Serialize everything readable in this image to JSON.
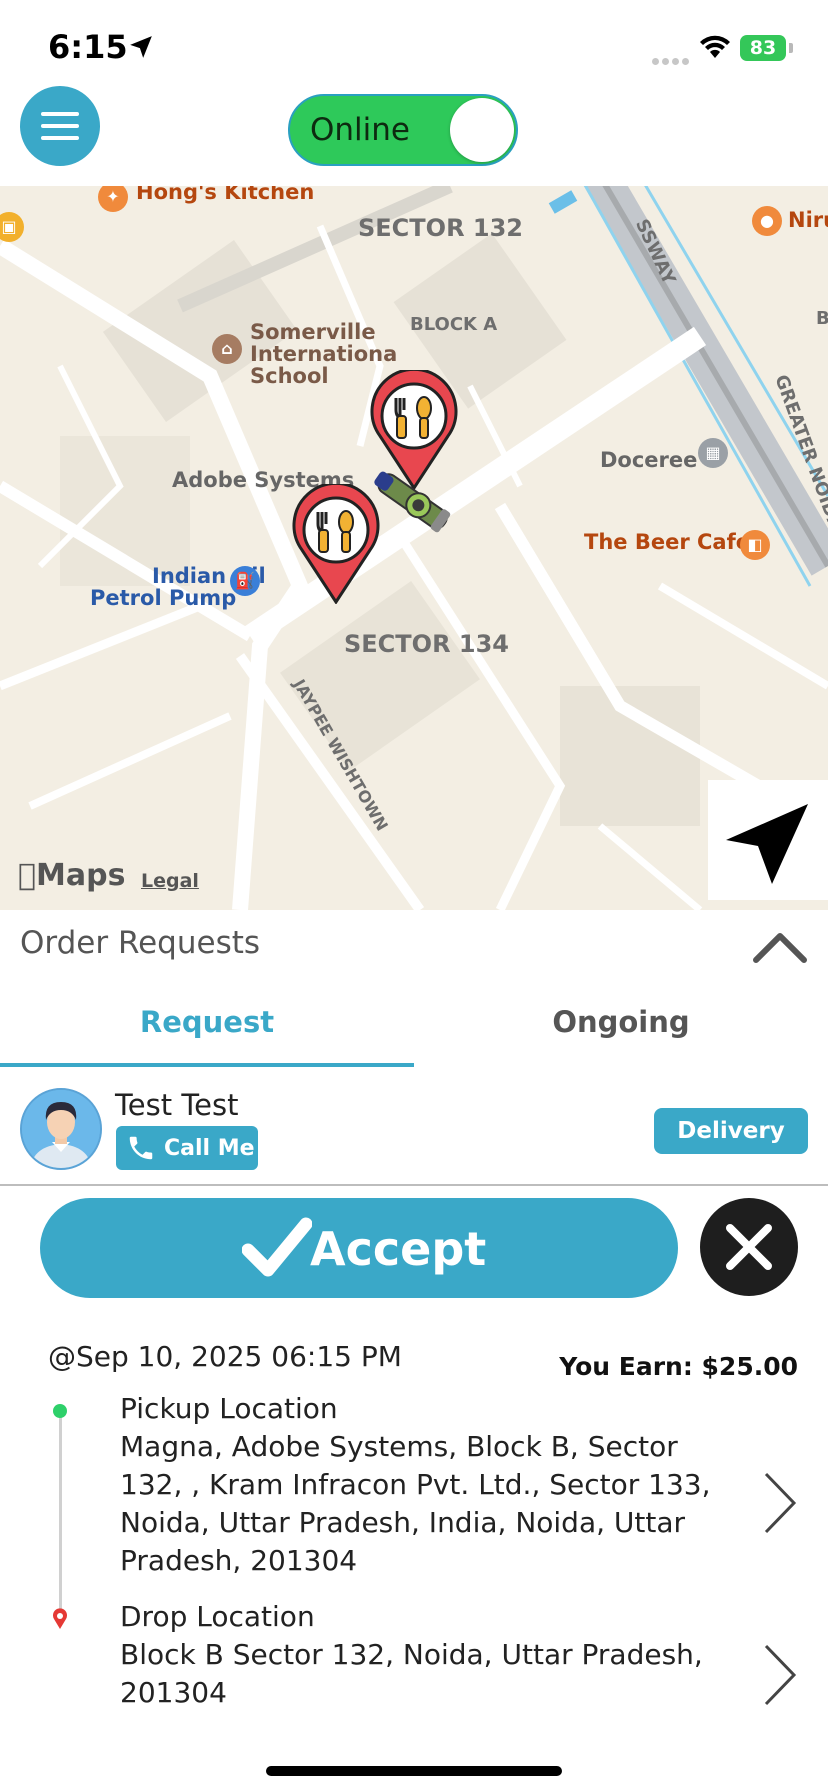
{
  "status_bar": {
    "time": "6:15",
    "battery": "83"
  },
  "header": {
    "toggle_label": "Online",
    "toggle_on": true
  },
  "map": {
    "labels": {
      "hongs_kitchen": "Hong's Kitchen",
      "sector_132": "SECTOR 132",
      "expressway_top": "SSWAY",
      "niru": "Niru",
      "block_a": "BLOCK A",
      "somerville_1": "Somerville",
      "somerville_2": "Internationa",
      "somerville_3": "School",
      "adobe": "Adobe Systems",
      "doceree": "Doceree",
      "greater_noida": "GREATER NOIDA E",
      "beer_cafe": "The Beer Cafe",
      "indian_oil_1": "Indian Oil",
      "indian_oil_2": "Petrol Pump",
      "sector_134": "SECTOR 134",
      "jaypee": "JAYPEE WISHTOWN",
      "b_edge": "B"
    },
    "maps_brand": "Maps",
    "legal": "Legal"
  },
  "orders": {
    "title": "Order Requests",
    "tabs": {
      "request": "Request",
      "ongoing": "Ongoing"
    },
    "active_tab": "request",
    "customer": {
      "name": "Test Test",
      "call_label": "Call Me",
      "type": "Delivery"
    },
    "accept_label": "Accept",
    "datetime": "@Sep 10, 2025 06:15 PM",
    "earn": "You Earn: $25.00",
    "pickup": {
      "title": "Pickup Location",
      "address": "Magna, Adobe Systems, Block B, Sector 132, , Kram Infracon Pvt. Ltd., Sector 133, Noida, Uttar Pradesh, India, Noida, Uttar Pradesh, 201304"
    },
    "drop": {
      "title": "Drop Location",
      "address": "Block B Sector 132, Noida, Uttar Pradesh, 201304"
    }
  },
  "colors": {
    "accent": "#3aa8c8",
    "online": "#2ec95a",
    "pin": "#e8474f"
  }
}
